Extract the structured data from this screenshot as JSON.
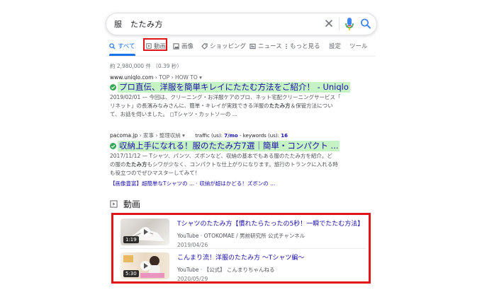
{
  "search": {
    "query": "服　たたみ方"
  },
  "tabs": [
    {
      "label": "すべて",
      "active": true,
      "icon": "search-icon"
    },
    {
      "label": "動画",
      "active": false,
      "icon": "video-icon"
    },
    {
      "label": "画像",
      "active": false,
      "icon": "image-icon"
    },
    {
      "label": "ショッピング",
      "active": false,
      "icon": "tag-icon"
    },
    {
      "label": "ニュース",
      "active": false,
      "icon": "news-icon"
    },
    {
      "label": "もっと見る",
      "active": false,
      "icon": "more-vertical-icon"
    }
  ],
  "tools": {
    "settings": "設定",
    "tools": "ツール"
  },
  "stats": "約 2,980,000 件 （0.39 秒）",
  "results": [
    {
      "cite_domain": "www.uniqlo.com",
      "cite_path": " › TOP › HOW TO",
      "title": "プロ直伝、洋服を簡単キレイにたたむ方法をご紹介！ - Uniqlo",
      "snippet_1": "2019/02/01 — 今回は、クリーニング・お洋服ケアのプロ、ネット宅配クリーニングサービス「",
      "snippet_2_pre": "リネット」の長濱みなみさんに、簡単・キレイが実践できる洋服の",
      "snippet_2_bold": "たたみ方",
      "snippet_2_post": "＆保管方法につい",
      "snippet_3": "て、お話を伺いました。 ◻Tシャツ・カットソーの ..."
    },
    {
      "cite_domain": "pacoma.jp",
      "cite_path": " › 家事 › 整理収納",
      "seo_traffic_label": "traffic (us):",
      "seo_traffic_value": "7/mo",
      "seo_keywords_label": "- keywords (us):",
      "seo_keywords_value": "16",
      "title": "収納上手になれる！服のたたみ方7選｜簡単・コンパクト ...",
      "snippet_1": "2017/11/12 — Tシャツ、パンツ、ズボンなど、収納の基本でもある服のたたみ方を紹介。ど",
      "snippet_2_pre": "の服の",
      "snippet_2_bold": "たたみ方",
      "snippet_2_post": "もシワが少なく、コンパクトな仕上がりになります。旅行のトランクに入れる時",
      "snippet_3": "も役立つのでぜひマスターしてみて！",
      "sitelinks": "【画像豊富】超簡単なTシャツの ... · 収納が超はかどる！ズボンの ..."
    }
  ],
  "videos": {
    "heading": "動画",
    "items": [
      {
        "title": "Tシャツのたたみ方【慣れたらたったの5秒！一瞬でたたむ方法】",
        "source": "YouTube",
        "channel": " · OTOKOMAE / 男前研究所 公式チャンネル",
        "date": "2019/04/26",
        "duration": "1:19"
      },
      {
        "title": "こんまり流！洋服のたたみ方 〜Tシャツ編〜",
        "source": "YouTube",
        "channel": " · 【公式】 こんまりちゃんねる",
        "date": "2020/05/29",
        "duration": "5:30"
      }
    ]
  },
  "colors": {
    "link": "#1a0dab",
    "accent": "#1a73e8",
    "highlight": "#c6f3c3",
    "annotation": "#e0151a"
  }
}
